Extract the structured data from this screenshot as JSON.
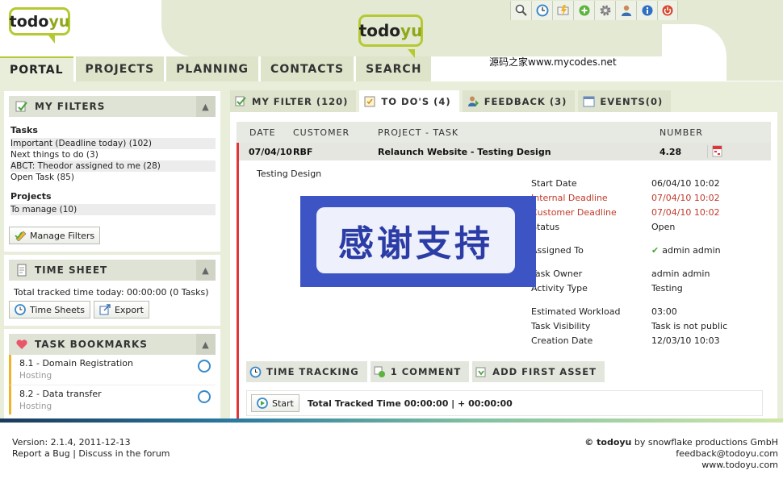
{
  "app": {
    "logo_main": "todo",
    "logo_accent": "yu",
    "watermark": "源码之家www.mycodes.net"
  },
  "toolbar": {
    "icons": [
      "search-icon",
      "clock-icon",
      "quick-create-icon",
      "add-icon",
      "settings-icon",
      "user-icon",
      "info-icon",
      "logout-icon"
    ]
  },
  "main_tabs": [
    "PORTAL",
    "PROJECTS",
    "PLANNING",
    "CONTACTS",
    "SEARCH"
  ],
  "filters": {
    "title": "MY FILTERS",
    "tasks_heading": "Tasks",
    "tasks": [
      "Important (Deadline today) (102)",
      "Next things to do (3)",
      "ABCT: Theodor assigned to me (28)",
      "Open Task (85)"
    ],
    "projects_heading": "Projects",
    "projects": [
      "To manage (10)"
    ],
    "manage_button": "Manage Filters"
  },
  "timesheet": {
    "title": "TIME SHEET",
    "total_text": "Total tracked time today: 00:00:00 (0 Tasks)",
    "timesheets_button": "Time Sheets",
    "export_button": "Export"
  },
  "bookmarks": {
    "title": "TASK BOOKMARKS",
    "items": [
      {
        "title": "8.1 - Domain Registration",
        "sub": "Hosting"
      },
      {
        "title": "8.2 - Data transfer",
        "sub": "Hosting"
      }
    ]
  },
  "right_tabs": [
    "MY FILTER (120)",
    "TO DO'S (4)",
    "FEEDBACK (3)",
    "EVENTS(0)"
  ],
  "table": {
    "headers": {
      "date": "DATE",
      "customer": "CUSTOMER",
      "project_task": "PROJECT - TASK",
      "number": "NUMBER"
    },
    "row": {
      "date": "07/04/10",
      "customer": "RBF",
      "project_task": "Relaunch Website - Testing Design",
      "number": "4.28"
    }
  },
  "detail": {
    "description": "Testing Design",
    "labels": {
      "start_date": "Start Date",
      "internal_deadline": "Internal Deadline",
      "customer_deadline": "Customer Deadline",
      "status": "Status",
      "assigned_to": "Assigned To",
      "task_owner": "Task Owner",
      "activity_type": "Activity Type",
      "estimated_workload": "Estimated Workload",
      "task_visibility": "Task Visibility",
      "creation_date": "Creation Date"
    },
    "values": {
      "start_date": "06/04/10 10:02",
      "internal_deadline": "07/04/10 10:02",
      "customer_deadline": "07/04/10 10:02",
      "status": "Open",
      "assigned_to": "admin admin",
      "task_owner": "admin admin",
      "activity_type": "Testing",
      "estimated_workload": "03:00",
      "task_visibility": "Task is not public",
      "creation_date": "12/03/10 10:03"
    }
  },
  "banner": {
    "text": "感谢支持"
  },
  "sub_tabs": [
    "TIME TRACKING",
    "1 COMMENT",
    "ADD FIRST ASSET"
  ],
  "time_tracking": {
    "start_button": "Start",
    "total": "Total Tracked Time 00:00:00 | + 00:00:00"
  },
  "footer": {
    "version": "Version: 2.1.4, 2011-12-13",
    "links": "Report a Bug | Discuss in the forum",
    "copyright_brand": "© todoyu",
    "copyright_rest": " by snowflake productions GmbH",
    "email": "feedback@todoyu.com",
    "website": "www.todoyu.com"
  },
  "colors": {
    "accent": "#b6c932",
    "header_bg": "#e3e9d2",
    "deadline_red": "#c0392b",
    "status_bar": "#e0353b"
  }
}
